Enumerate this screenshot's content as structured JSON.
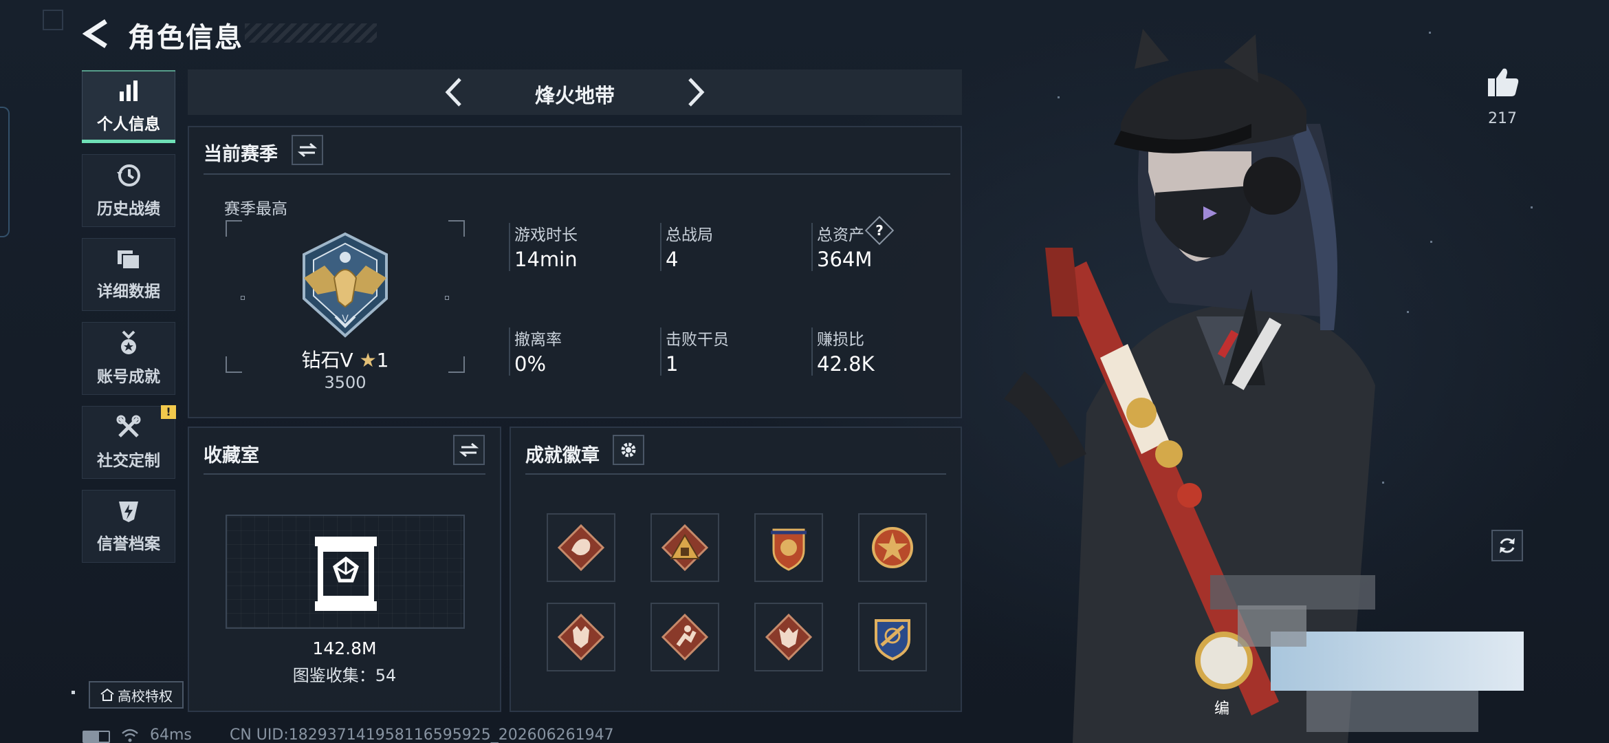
{
  "header": {
    "title": "角色信息"
  },
  "sidebar": {
    "items": [
      {
        "label": "个人信息",
        "icon": "bar-chart-icon",
        "active": true
      },
      {
        "label": "历史战绩",
        "icon": "history-clock-icon",
        "active": false
      },
      {
        "label": "详细数据",
        "icon": "folder-icon",
        "active": false
      },
      {
        "label": "账号成就",
        "icon": "medal-icon",
        "active": false
      },
      {
        "label": "社交定制",
        "icon": "wrench-icon",
        "active": false,
        "badge": "!"
      },
      {
        "label": "信誉档案",
        "icon": "shield-bolt-icon",
        "active": false
      }
    ],
    "campus_button": "高校特权"
  },
  "mode": {
    "name": "烽火地带"
  },
  "season": {
    "title": "当前赛季",
    "best_label": "赛季最高",
    "rank_name": "钻石V",
    "rank_stars": "1",
    "rank_points": "3500",
    "stats": [
      {
        "label": "游戏时长",
        "value": "14min"
      },
      {
        "label": "总战局",
        "value": "4"
      },
      {
        "label": "总资产",
        "value": "364M",
        "help": "?"
      },
      {
        "label": "撤离率",
        "value": "0%"
      },
      {
        "label": "击败干员",
        "value": "1"
      },
      {
        "label": "赚损比",
        "value": "42.8K"
      }
    ]
  },
  "collection": {
    "title": "收藏室",
    "value": "142.8M",
    "count_text": "图鉴收集：54"
  },
  "achievements": {
    "title": "成就徽章",
    "badges": [
      "dragon-badge-icon",
      "triangle-badge-icon",
      "shield-badge-icon",
      "star-badge-icon",
      "wolf-badge-icon",
      "runner-badge-icon",
      "wolf-badge-icon-2",
      "crest-badge-icon"
    ]
  },
  "right": {
    "likes": "217",
    "name_partial": "编"
  },
  "footer": {
    "ping": "64ms",
    "uid": "CN UID:18293714195811659592​5_202606261947"
  },
  "colors": {
    "accent": "#6fe0b6",
    "warning": "#f2c94c",
    "panel": "#1b232d"
  }
}
